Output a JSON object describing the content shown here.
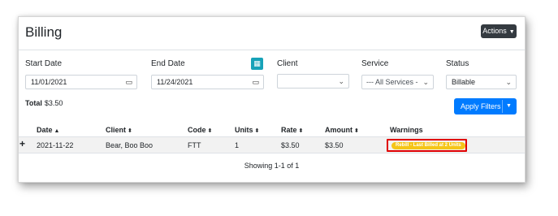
{
  "header": {
    "title": "Billing",
    "actions_label": "Actions"
  },
  "filters": {
    "start_date": {
      "label": "Start Date",
      "value": "11/01/2021"
    },
    "end_date": {
      "label": "End Date",
      "value": "11/24/2021"
    },
    "client": {
      "label": "Client",
      "value": ""
    },
    "service": {
      "label": "Service",
      "value": "--- All Services -"
    },
    "status": {
      "label": "Status",
      "value": "Billable"
    }
  },
  "total": {
    "label": "Total",
    "value": "$3.50"
  },
  "apply_filters_label": "Apply Filters",
  "table": {
    "columns": [
      "Date",
      "Client",
      "Code",
      "Units",
      "Rate",
      "Amount",
      "Warnings"
    ],
    "rows": [
      {
        "date": "2021-11-22",
        "client": "Bear, Boo Boo",
        "code": "FTT",
        "units": "1",
        "rate": "$3.50",
        "amount": "$3.50",
        "warning": "Rebill - Last Billed at 2 Units"
      }
    ]
  },
  "pagination_text": "Showing 1-1 of 1",
  "colors": {
    "accent_blue": "#007bff",
    "teal": "#17a2b8",
    "warning_badge": "#f5c518",
    "highlight_red": "#e00000",
    "dark_button": "#343a40"
  }
}
